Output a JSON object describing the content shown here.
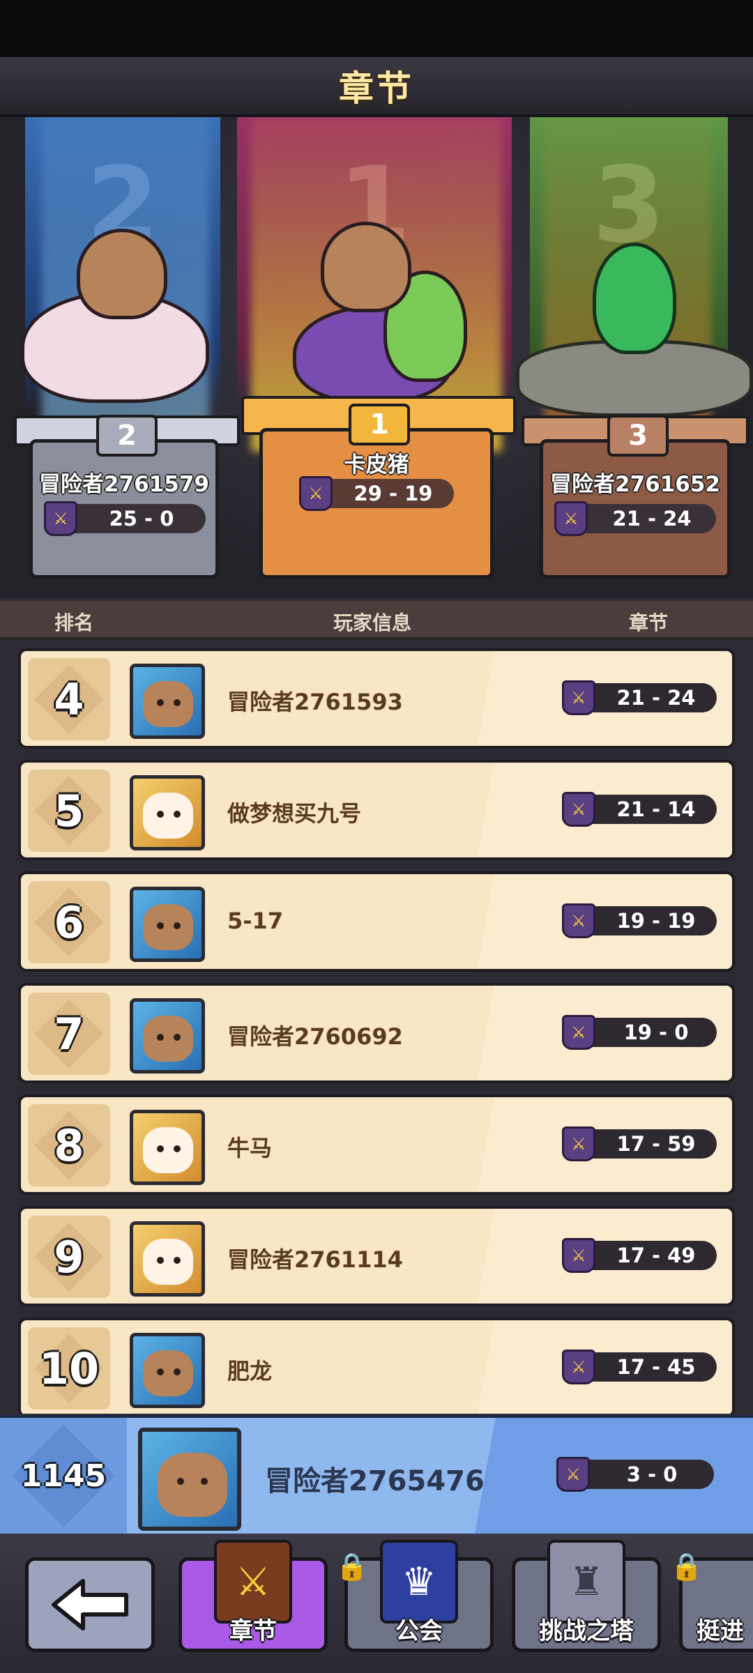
{
  "header": {
    "title": "章节"
  },
  "podium": [
    {
      "rank": "2",
      "banner_num": "2",
      "name": "冒险者2761579",
      "score": "25 - 0"
    },
    {
      "rank": "1",
      "banner_num": "1",
      "name": "卡皮猪",
      "score": "29 - 19"
    },
    {
      "rank": "3",
      "banner_num": "3",
      "name": "冒险者2761652",
      "score": "21 - 24"
    }
  ],
  "table_header": {
    "rank": "排名",
    "player": "玩家信息",
    "chapter": "章节"
  },
  "rows": [
    {
      "rank": "4",
      "name": "冒险者2761593",
      "score": "21 - 24",
      "avatar": "capybara"
    },
    {
      "rank": "5",
      "name": "做梦想买九号",
      "score": "21 - 14",
      "avatar": "girl"
    },
    {
      "rank": "6",
      "name": "5-17",
      "score": "19 - 19",
      "avatar": "capybara"
    },
    {
      "rank": "7",
      "name": "冒险者2760692",
      "score": "19 - 0",
      "avatar": "capybara"
    },
    {
      "rank": "8",
      "name": "牛马",
      "score": "17 - 59",
      "avatar": "girl"
    },
    {
      "rank": "9",
      "name": "冒险者2761114",
      "score": "17 - 49",
      "avatar": "girl"
    },
    {
      "rank": "10",
      "name": "肥龙",
      "score": "17 - 45",
      "avatar": "capybara"
    }
  ],
  "self": {
    "rank": "1145",
    "name": "冒险者2765476",
    "score": "3 - 0"
  },
  "bottom_nav": {
    "chapter": "章节",
    "guild": "公会",
    "tower": "挑战之塔",
    "advance": "挺进"
  }
}
